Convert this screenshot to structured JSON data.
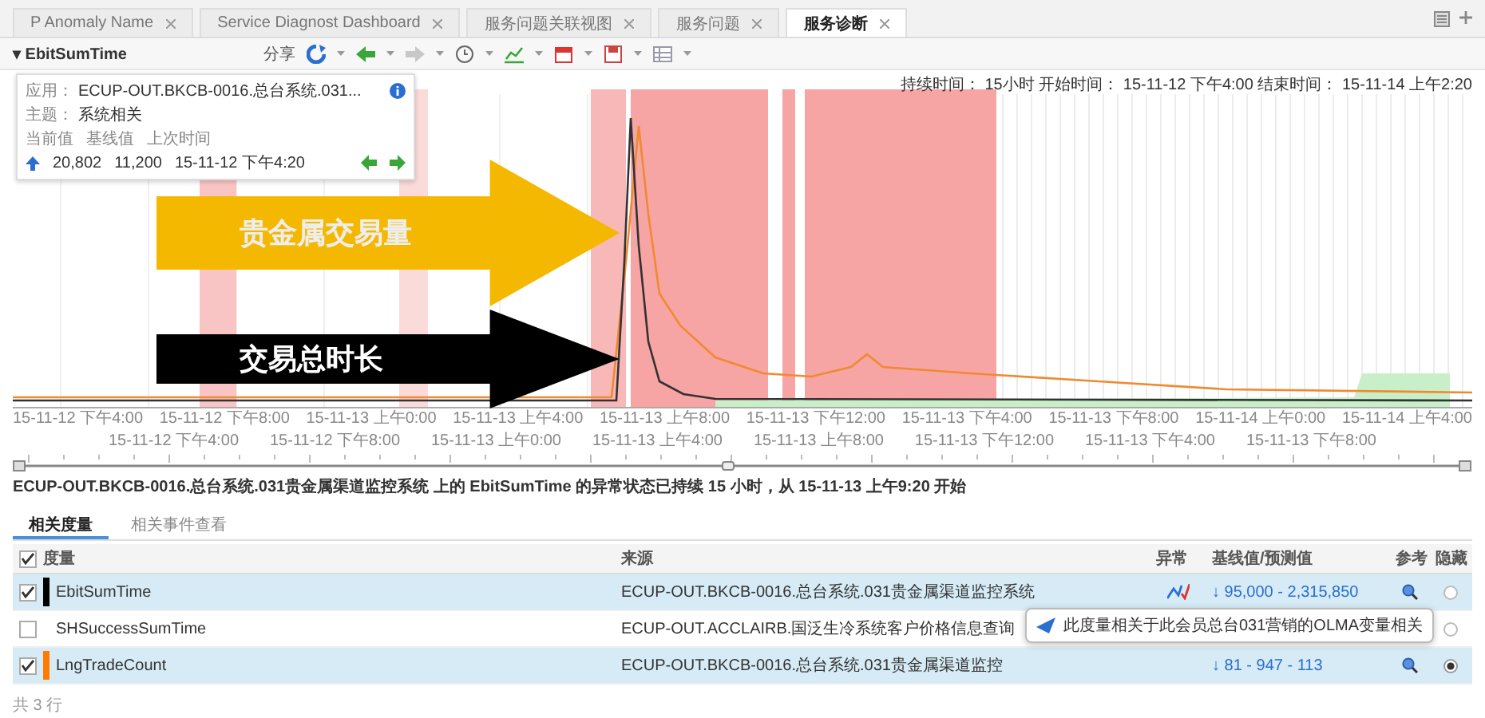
{
  "tabs": [
    {
      "label": "P Anomaly Name",
      "selected": false
    },
    {
      "label": "Service Diagnost Dashboard",
      "selected": false
    },
    {
      "label": "服务问题关联视图",
      "selected": false
    },
    {
      "label": "服务问题",
      "selected": false
    },
    {
      "label": "服务诊断",
      "selected": true
    }
  ],
  "toolbar": {
    "metric": "▾ EbitSumTime",
    "share": "分享"
  },
  "info_card": {
    "app_label": "应用：",
    "app": "ECUP-OUT.BKCB-0016.总台系统.031...",
    "topic_label": "主题：",
    "topic": "系统相关",
    "columns": [
      "当前值",
      "基线值",
      "上次时间"
    ],
    "values": [
      "20,802",
      "11,200",
      "15-11-12 下午4:20"
    ]
  },
  "period": "持续时间： 15小时 开始时间： 15-11-12 下午4:00 结束时间： 15-11-14 上午2:20",
  "callouts": [
    {
      "label": "贵金属交易量",
      "color": "#f5b800"
    },
    {
      "label": "交易总时长",
      "color": "#000000"
    }
  ],
  "axis_labels": [
    "15-11-12 下午4:00",
    "15-11-12 下午8:00",
    "15-11-13 上午0:00",
    "15-11-13 上午4:00",
    "15-11-13 上午8:00",
    "15-11-13 下午12:00",
    "15-11-13 下午4:00",
    "15-11-13 下午8:00",
    "15-11-14 上午0:00",
    "15-11-14 上午4:00"
  ],
  "overview_labels": [
    "15-11-12 下午4:00",
    "15-11-12 下午8:00",
    "15-11-13 上午0:00",
    "15-11-13 上午4:00",
    "15-11-13 上午8:00",
    "15-11-13 下午12:00",
    "15-11-13 下午4:00",
    "15-11-13 下午8:00"
  ],
  "range_slider": {
    "level": 0.49
  },
  "summary": "ECUP-OUT.BKCB-0016.总台系统.031贵金属渠道监控系统 上的 EbitSumTime 的异常状态已持续 15 小时，从 15-11-13 上午9:20 开始",
  "subtabs": [
    {
      "label": "相关度量",
      "selected": true
    },
    {
      "label": "相关事件查看",
      "selected": false
    }
  ],
  "table": {
    "columns": [
      "度量",
      "来源",
      "异常",
      "基线值/预测值",
      "参考",
      "隐藏"
    ],
    "all_checked": true,
    "rows": [
      {
        "metric": "EbitSumTime",
        "checked": true,
        "color": "#000000",
        "source": "ECUP-OUT.BKCB-0016.总台系统.031贵金属渠道监控系统",
        "anomaly": true,
        "value": "↓ 95,000 - 2,315,850",
        "reference": true,
        "hidden": false
      },
      {
        "metric": "SHSuccessSumTime",
        "checked": false,
        "source": "ECUP-OUT.ACCLAIRB.国泛生冷系统客户价格信息查询",
        "anomaly": false,
        "reference": false,
        "hidden": false
      },
      {
        "metric": "LngTradeCount",
        "checked": true,
        "color": "#ff7a00",
        "source": "ECUP-OUT.BKCB-0016.总台系统.031贵金属渠道监控",
        "anomaly": false,
        "value": "↓ 81 - 947 - 113",
        "reference": true,
        "hidden": true
      }
    ]
  },
  "tooltip": "此度量相关于此会员总台031营销的OLMA变量相关",
  "footer": "共 3 行"
}
